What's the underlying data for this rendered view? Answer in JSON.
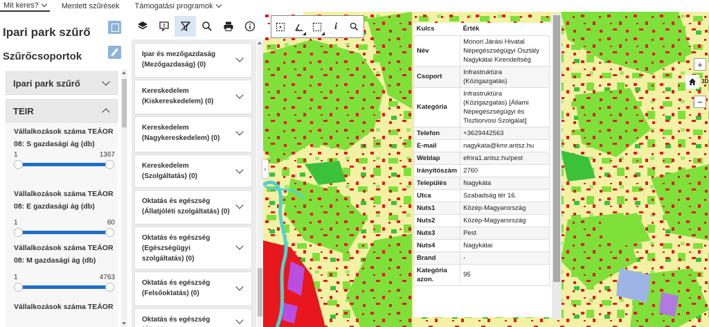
{
  "top_menu": {
    "items": [
      {
        "label": "Mit keres?",
        "has_dropdown": true
      },
      {
        "label": "Mentett szűrések",
        "has_dropdown": false
      },
      {
        "label": "Támogatási programok",
        "has_dropdown": true
      }
    ]
  },
  "left_panel": {
    "title": "Ipari park szűrő",
    "subtitle": "Szűrőcsoportok",
    "accordions": [
      {
        "label": "Ipari park szűrő",
        "expanded": false
      },
      {
        "label": "TEIR",
        "expanded": true
      }
    ],
    "filters": [
      {
        "label": "Vállalkozások száma TEÁOR 08: S gazdasági ág (db)",
        "min": "1",
        "max": "1367"
      },
      {
        "label": "Vállalkozások száma TEÁOR 08: E gazdasági ág (db)",
        "min": "1",
        "max": "60"
      },
      {
        "label": "Vállalkozások száma TEÁOR 08: M gazdasági ág (db)",
        "min": "1",
        "max": "4763"
      },
      {
        "label": "Vállalkozások száma TEÁOR",
        "min": "",
        "max": ""
      }
    ]
  },
  "toolbar": {
    "icons": [
      "layers-icon",
      "comment-icon",
      "filter-off-icon",
      "search-icon",
      "print-icon",
      "info-icon"
    ],
    "active_index": 2
  },
  "categories": [
    "Ipar és mezőgazdaság (Mezőgazdaság)  (0)",
    "Kereskedelem (Kiskereskedelem)  (0)",
    "Kereskedelem (Nagykereskedelem)  (0)",
    "Kereskedelem (Szolgáltatás)  (0)",
    "Oktatás és egészség (Állatjóléti szolgáltatás)  (0)",
    "Oktatás és egészség (Egészségügyi szolgáltatás)  (0)",
    "Oktatás és egészség (Felsőoktatás)  (0)",
    "Oktatás és egészség (Általános..."
  ],
  "map_tools": {
    "icons": [
      "select-box-icon",
      "measure-icon",
      "lasso-icon",
      "identify-icon",
      "zoom-icon"
    ],
    "identify_label": "i"
  },
  "info_table": {
    "headers": [
      "Kulcs",
      "Érték"
    ],
    "rows": [
      [
        "Név",
        "Monori Járási Hivatal Népegészségügyi Osztály Nagykátai Kirendeltség"
      ],
      [
        "Csoport",
        "Infrastruktúra (Közigazgatás)"
      ],
      [
        "Kategória",
        "Infrastruktúra (Közigazgatás) [Állami Népegészségügyi és Tisztiorvosi Szolgálat]"
      ],
      [
        "Telefon",
        "+3629442563"
      ],
      [
        "E-mail",
        "nagykata@kmr.antsz.hu"
      ],
      [
        "Weblap",
        "efrira1.antsz.hu/pest"
      ],
      [
        "Irányítószám",
        "2760"
      ],
      [
        "Település",
        "Nagykáta"
      ],
      [
        "Utca",
        "Szabadság tér 16."
      ],
      [
        "Nuts1",
        "Közép-Magyarország"
      ],
      [
        "Nuts2",
        "Közép-Magyarország"
      ],
      [
        "Nuts3",
        "Pest"
      ],
      [
        "Nuts4",
        "Nagykátai"
      ],
      [
        "Brand",
        "-"
      ],
      [
        "Kategória azon.",
        "95"
      ]
    ]
  },
  "map_controls": {
    "zoom_in": "+",
    "zoom_out": "−",
    "view_3d": "3D"
  },
  "colors": {
    "accent": "#1f6ec7",
    "map_base": "#f4f1a4",
    "map_green": "#7fe03a",
    "map_red": "#e8171d",
    "map_water": "#4fd3d0"
  }
}
